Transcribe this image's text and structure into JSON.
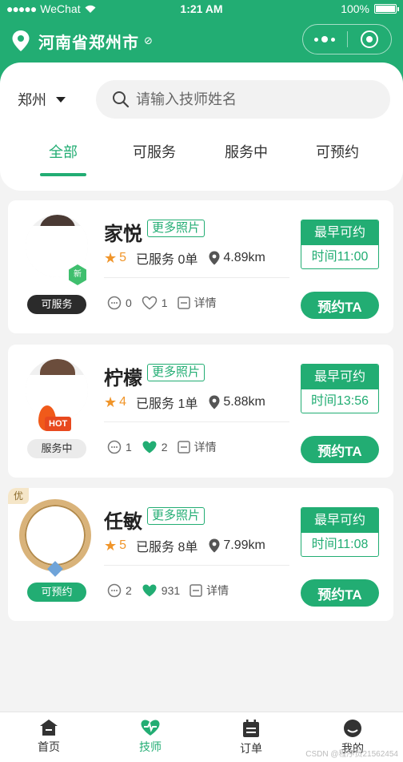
{
  "status_bar": {
    "carrier": "WeChat",
    "time": "1:21 AM",
    "battery": "100%"
  },
  "header": {
    "location": "河南省郑州市",
    "brand_color": "#22ad73"
  },
  "filter": {
    "city": "郑州",
    "search_placeholder": "请输入技师姓名",
    "tabs": [
      "全部",
      "可服务",
      "服务中",
      "可预约"
    ],
    "active_tab": "全部"
  },
  "technicians": [
    {
      "name": "家悦",
      "more_photos": "更多照片",
      "rating": "5",
      "served": "已服务 0单",
      "distance": "4.89km",
      "comments": "0",
      "likes": "1",
      "details": "详情",
      "earliest_label": "最早可约",
      "earliest_time": "时间11:00",
      "book": "预约TA",
      "status": "可服务",
      "badge": "新"
    },
    {
      "name": "柠檬",
      "more_photos": "更多照片",
      "rating": "4",
      "served": "已服务 1单",
      "distance": "5.88km",
      "comments": "1",
      "likes": "2",
      "details": "详情",
      "earliest_label": "最早可约",
      "earliest_time": "时间13:56",
      "book": "预约TA",
      "status": "服务中",
      "badge": "HOT"
    },
    {
      "name": "任敏",
      "more_photos": "更多照片",
      "rating": "5",
      "served": "已服务 8单",
      "distance": "7.99km",
      "comments": "2",
      "likes": "931",
      "details": "详情",
      "earliest_label": "最早可约",
      "earliest_time": "时间11:08",
      "book": "预约TA",
      "status": "可预约",
      "badge": "优"
    }
  ],
  "tabbar": {
    "items": [
      "首页",
      "技师",
      "订单",
      "我的"
    ],
    "active": "技师"
  },
  "watermark": "CSDN @程序员21562454"
}
